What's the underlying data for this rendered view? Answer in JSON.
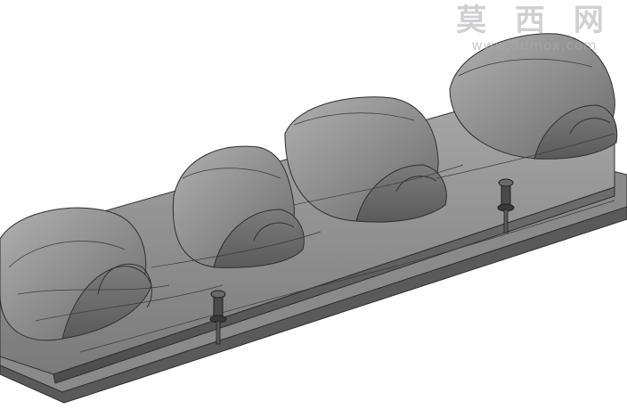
{
  "scene": {
    "subject": "valve-cover-cad-model",
    "icon": "3d-model-render"
  },
  "watermark": {
    "chinese_text": "莫 西 网",
    "url_text": "www.3dmox.com"
  },
  "colors": {
    "background": "#ffffff",
    "body_light": "#9a9a9a",
    "body_mid": "#808080",
    "body_dark": "#5e5e5e",
    "edge_lines": "#2f2f2f",
    "flange": "#8c8c8c",
    "watermark": "#b4b4b8"
  }
}
